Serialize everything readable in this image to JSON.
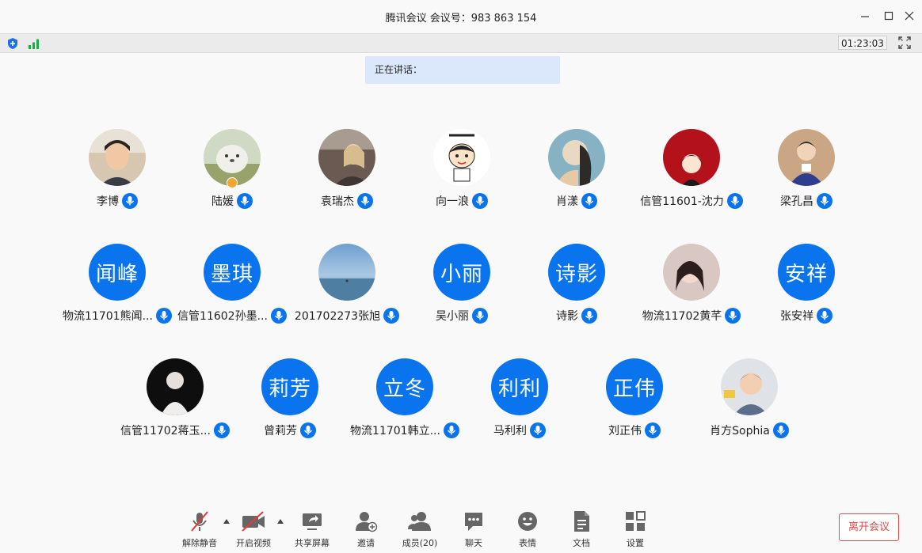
{
  "window": {
    "title": "腾讯会议 会议号：983 863 154"
  },
  "infobar": {
    "timer": "01:23:03"
  },
  "speaking": {
    "label": "正在讲话："
  },
  "participants": [
    {
      "name": "李博"
    },
    {
      "name": "陆媛"
    },
    {
      "name": "袁瑞杰"
    },
    {
      "name": "向一浪"
    },
    {
      "name": "肖漾"
    },
    {
      "name": "信管11601-沈力"
    },
    {
      "name": "梁孔昌"
    },
    {
      "name": "物流11701熊闻...",
      "avatar_text": "闻峰"
    },
    {
      "name": "信管11602孙墨...",
      "avatar_text": "墨琪"
    },
    {
      "name": "201702273张旭"
    },
    {
      "name": "吴小丽",
      "avatar_text": "小丽"
    },
    {
      "name": "诗影",
      "avatar_text": "诗影"
    },
    {
      "name": "物流11702黄芊"
    },
    {
      "name": "张安祥",
      "avatar_text": "安祥"
    },
    {
      "name": "信管11702蒋玉..."
    },
    {
      "name": "曾莉芳",
      "avatar_text": "莉芳"
    },
    {
      "name": "物流11701韩立...",
      "avatar_text": "立冬"
    },
    {
      "name": "马利利",
      "avatar_text": "利利"
    },
    {
      "name": "刘正伟",
      "avatar_text": "正伟"
    },
    {
      "name": "肖方Sophia"
    }
  ],
  "toolbar": {
    "mute": "解除静音",
    "video": "开启视频",
    "share": "共享屏幕",
    "invite": "邀请",
    "members": "成员(20)",
    "chat": "聊天",
    "emoji": "表情",
    "docs": "文档",
    "settings": "设置",
    "leave": "离开会议"
  },
  "colors": {
    "accent": "#0a74ee",
    "leave": "#e04a4a",
    "speaking_bg": "#dbe8fb"
  }
}
